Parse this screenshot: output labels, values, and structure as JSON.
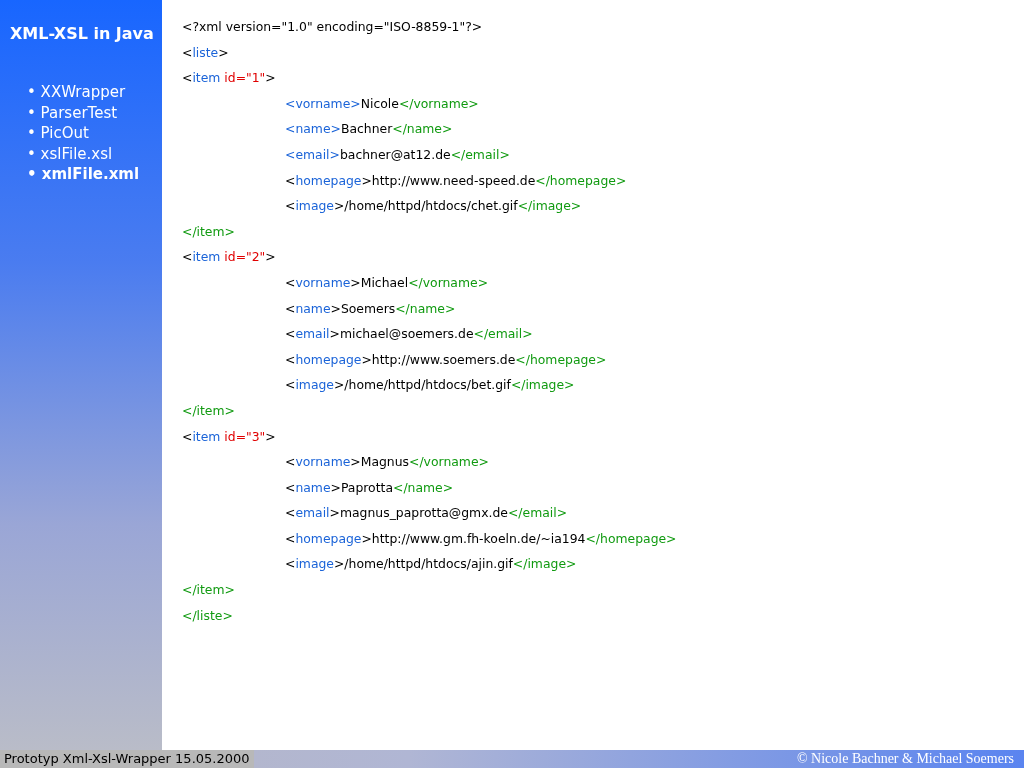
{
  "sidebar": {
    "title": "XML-XSL in Java",
    "items": [
      {
        "label": "• XXWrapper",
        "selected": false
      },
      {
        "label": "• ParserTest",
        "selected": false
      },
      {
        "label": "• PicOut",
        "selected": false
      },
      {
        "label": "• xslFile.xsl",
        "selected": false
      },
      {
        "label": "• xmlFile.xml",
        "selected": true
      }
    ]
  },
  "code": [
    {
      "segments": [
        {
          "text": "<?xml version=\"1.0\" encoding=\"ISO-8859-1\"?>",
          "kind": "plain"
        }
      ]
    },
    {
      "segments": [
        {
          "text": "<",
          "kind": "plain"
        },
        {
          "text": "liste",
          "kind": "tag"
        },
        {
          "text": ">",
          "kind": "plain"
        }
      ]
    },
    {
      "segments": [
        {
          "text": "<",
          "kind": "plain"
        },
        {
          "text": "item",
          "kind": "tag"
        },
        {
          "text": " id=\"1\"",
          "kind": "attr"
        },
        {
          "text": ">",
          "kind": "plain"
        }
      ],
      "children": [
        {
          "segments": [
            {
              "text": "<vorname>",
              "kind": "tag"
            },
            {
              "text": "Nicole",
              "kind": "plain"
            },
            {
              "text": "</vorname>",
              "kind": "close"
            }
          ]
        },
        {
          "segments": [
            {
              "text": "<name>",
              "kind": "tag"
            },
            {
              "text": "Bachner",
              "kind": "plain"
            },
            {
              "text": "</name>",
              "kind": "close"
            }
          ]
        },
        {
          "segments": [
            {
              "text": "<email>",
              "kind": "tag"
            },
            {
              "text": "bachner@at12.de",
              "kind": "plain"
            },
            {
              "text": "</email>",
              "kind": "close"
            }
          ]
        },
        {
          "segments": [
            {
              "text": "<",
              "kind": "plain"
            },
            {
              "text": "homepage",
              "kind": "tag"
            },
            {
              "text": ">http://www.need-speed.de",
              "kind": "plain"
            },
            {
              "text": "</homepage>",
              "kind": "close"
            }
          ]
        },
        {
          "segments": [
            {
              "text": "<",
              "kind": "plain"
            },
            {
              "text": "image",
              "kind": "tag"
            },
            {
              "text": ">/home/httpd/htdocs/chet.gif",
              "kind": "plain"
            },
            {
              "text": "</image>",
              "kind": "close"
            }
          ]
        }
      ]
    },
    {
      "segments": [
        {
          "text": "</item>",
          "kind": "close"
        }
      ]
    },
    {
      "segments": [
        {
          "text": "<",
          "kind": "plain"
        },
        {
          "text": "item",
          "kind": "tag"
        },
        {
          "text": " id=\"2\"",
          "kind": "attr"
        },
        {
          "text": ">",
          "kind": "plain"
        }
      ],
      "children": [
        {
          "segments": [
            {
              "text": "<",
              "kind": "plain"
            },
            {
              "text": "vorname",
              "kind": "tag"
            },
            {
              "text": ">Michael",
              "kind": "plain"
            },
            {
              "text": "</vorname>",
              "kind": "close"
            }
          ]
        },
        {
          "segments": [
            {
              "text": "<",
              "kind": "plain"
            },
            {
              "text": "name",
              "kind": "tag"
            },
            {
              "text": ">Soemers",
              "kind": "plain"
            },
            {
              "text": "</name>",
              "kind": "close"
            }
          ]
        },
        {
          "segments": [
            {
              "text": "<",
              "kind": "plain"
            },
            {
              "text": "email",
              "kind": "tag"
            },
            {
              "text": ">michael@soemers.de",
              "kind": "plain"
            },
            {
              "text": "</email>",
              "kind": "close"
            }
          ]
        },
        {
          "segments": [
            {
              "text": "<",
              "kind": "plain"
            },
            {
              "text": "homepage",
              "kind": "tag"
            },
            {
              "text": ">http://www.soemers.de",
              "kind": "plain"
            },
            {
              "text": "</homepage>",
              "kind": "close"
            }
          ]
        },
        {
          "segments": [
            {
              "text": "<",
              "kind": "plain"
            },
            {
              "text": "image",
              "kind": "tag"
            },
            {
              "text": ">/home/httpd/htdocs/bet.gif",
              "kind": "plain"
            },
            {
              "text": "</image>",
              "kind": "close"
            }
          ]
        }
      ]
    },
    {
      "segments": [
        {
          "text": "</item>",
          "kind": "close"
        }
      ]
    },
    {
      "segments": [
        {
          "text": "<",
          "kind": "plain"
        },
        {
          "text": "item",
          "kind": "tag"
        },
        {
          "text": " id=\"3\"",
          "kind": "attr"
        },
        {
          "text": ">",
          "kind": "plain"
        }
      ],
      "children": [
        {
          "segments": [
            {
              "text": "<",
              "kind": "plain"
            },
            {
              "text": "vorname",
              "kind": "tag"
            },
            {
              "text": ">Magnus",
              "kind": "plain"
            },
            {
              "text": "</vorname>",
              "kind": "close"
            }
          ]
        },
        {
          "segments": [
            {
              "text": "<",
              "kind": "plain"
            },
            {
              "text": "name",
              "kind": "tag"
            },
            {
              "text": ">Paprotta",
              "kind": "plain"
            },
            {
              "text": "</name>",
              "kind": "close"
            }
          ]
        },
        {
          "segments": [
            {
              "text": "<",
              "kind": "plain"
            },
            {
              "text": "email",
              "kind": "tag"
            },
            {
              "text": ">magnus_paprotta@gmx.de",
              "kind": "plain"
            },
            {
              "text": "</email>",
              "kind": "close"
            }
          ]
        },
        {
          "segments": [
            {
              "text": "<",
              "kind": "plain"
            },
            {
              "text": "homepage",
              "kind": "tag"
            },
            {
              "text": ">http://www.gm.fh-koeln.de/~ia194",
              "kind": "plain"
            },
            {
              "text": "</homepage>",
              "kind": "close"
            }
          ]
        },
        {
          "segments": [
            {
              "text": "<",
              "kind": "plain"
            },
            {
              "text": "image",
              "kind": "tag"
            },
            {
              "text": ">/home/httpd/htdocs/ajin.gif",
              "kind": "plain"
            },
            {
              "text": "</image>",
              "kind": "close"
            }
          ]
        }
      ]
    },
    {
      "segments": [
        {
          "text": "</item>",
          "kind": "close"
        }
      ]
    },
    {
      "segments": [
        {
          "text": "</liste>",
          "kind": "close"
        }
      ]
    }
  ],
  "footer": {
    "left": "Prototyp Xml-Xsl-Wrapper 15.05.2000",
    "right": "© Nicole Bachner & Michael Soemers"
  }
}
